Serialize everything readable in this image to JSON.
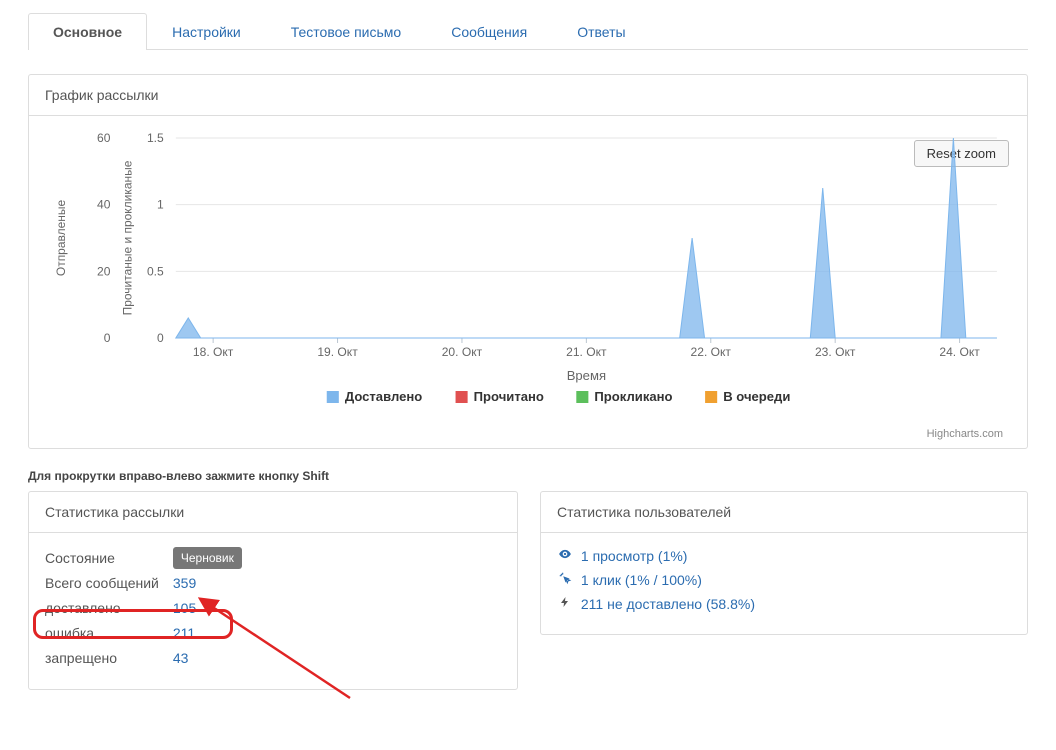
{
  "tabs": [
    {
      "label": "Основное",
      "active": true
    },
    {
      "label": "Настройки",
      "active": false
    },
    {
      "label": "Тестовое письмо",
      "active": false
    },
    {
      "label": "Сообщения",
      "active": false
    },
    {
      "label": "Ответы",
      "active": false
    }
  ],
  "chart_panel": {
    "title": "График рассылки",
    "reset_zoom": "Reset zoom",
    "attribution": "Highcharts.com",
    "scroll_hint": "Для прокрутки вправо-влево зажмите кнопку Shift"
  },
  "chart_data": {
    "type": "line",
    "xlabel": "Время",
    "x_categories": [
      "18. Окт",
      "19. Окт",
      "20. Окт",
      "21. Окт",
      "22. Окт",
      "23. Окт",
      "24. Окт"
    ],
    "y_left": {
      "label": "Отправленые",
      "ticks": [
        0,
        20,
        40,
        60
      ],
      "range": [
        0,
        60
      ]
    },
    "y_right": {
      "label": "Прочитаные и прокликаные",
      "ticks": [
        0,
        0.5,
        1,
        1.5
      ],
      "range": [
        0,
        1.5
      ]
    },
    "legend": [
      {
        "name": "Доставлено",
        "color": "#7db6ec"
      },
      {
        "name": "Прочитано",
        "color": "#e05050"
      },
      {
        "name": "Прокликано",
        "color": "#5cbf5c"
      },
      {
        "name": "В очереди",
        "color": "#f0a030"
      }
    ],
    "series": [
      {
        "name": "Доставлено",
        "color": "#7db6ec",
        "x": [
          17.7,
          17.8,
          17.9,
          21.75,
          21.85,
          21.95,
          22.8,
          22.9,
          23.0,
          23.85,
          23.95,
          24.05
        ],
        "values": [
          0,
          6,
          0,
          0,
          30,
          0,
          0,
          45,
          0,
          0,
          60,
          0
        ]
      }
    ]
  },
  "stats_panel": {
    "title": "Статистика рассылки",
    "rows": {
      "state_label": "Состояние",
      "state_value": "Черновик",
      "total_label": "Всего сообщений",
      "total_value": "359",
      "delivered_label": "доставлено",
      "delivered_value": "105",
      "error_label": "ошибка",
      "error_value": "211",
      "forbidden_label": "запрещено",
      "forbidden_value": "43"
    }
  },
  "users_panel": {
    "title": "Статистика пользователей",
    "views": "1 просмотр (1%)",
    "clicks": "1 клик (1% / 100%)",
    "undelivered": "211 не доставлено (58.8%)"
  }
}
